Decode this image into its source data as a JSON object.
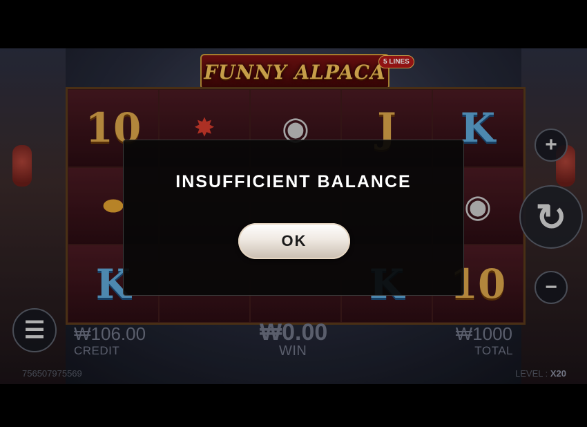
{
  "game": {
    "title": "FUNNY ALPACA",
    "lines_badge": "5 LINES"
  },
  "reels": [
    [
      "10",
      "firecracker",
      "gong",
      "J",
      "K"
    ],
    [
      "lantern",
      "",
      "",
      "",
      "gong"
    ],
    [
      "K",
      "",
      "",
      "K",
      "10"
    ]
  ],
  "stats": {
    "credit_value": "₩106.00",
    "credit_label": "CREDIT",
    "win_value": "₩0.00",
    "win_label": "WIN",
    "total_value": "₩1000",
    "total_label": "TOTAL"
  },
  "footer": {
    "session_id": "756507975569",
    "level_label": "LEVEL :",
    "level_value": "X20"
  },
  "controls": {
    "plus_icon": "+",
    "minus_icon": "−",
    "spin_icon": "↻",
    "menu_icon": "☰"
  },
  "dialog": {
    "message": "INSUFFICIENT BALANCE",
    "ok_label": "OK"
  }
}
